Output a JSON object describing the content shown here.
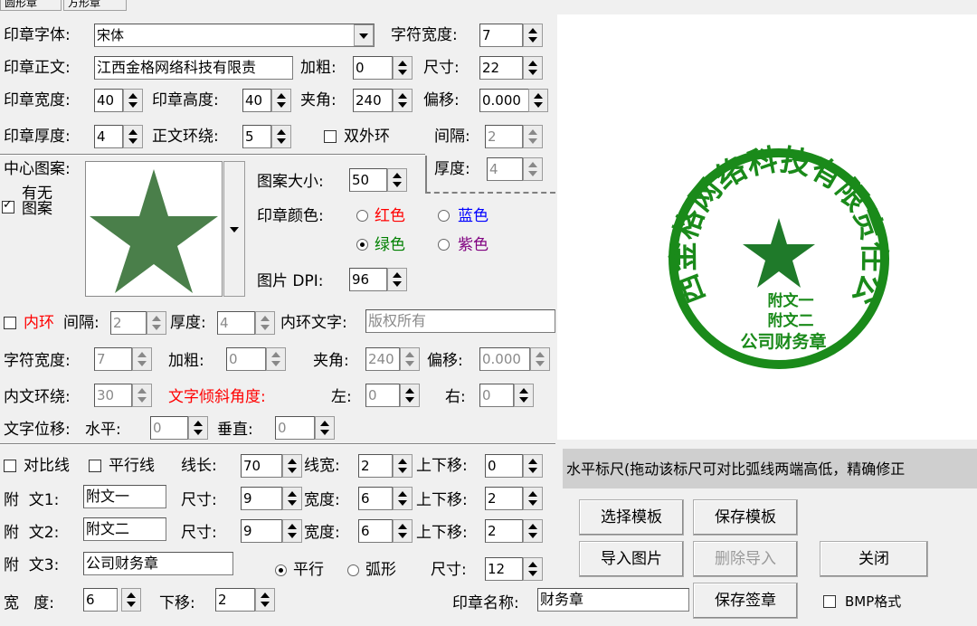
{
  "tabs": [
    "圆形章",
    "方形章"
  ],
  "font": {
    "label": "印章字体:",
    "value": "宋体"
  },
  "char_width": {
    "label": "字符宽度:",
    "value": "7"
  },
  "main_text": {
    "label": "印章正文:",
    "value": "江西金格网络科技有限责"
  },
  "bold": {
    "label": "加粗:",
    "value": "0"
  },
  "size": {
    "label": "尺寸:",
    "value": "22"
  },
  "seal_width": {
    "label": "印章宽度:",
    "value": "40"
  },
  "seal_height": {
    "label": "印章高度:",
    "value": "40"
  },
  "angle": {
    "label": "夹角:",
    "value": "240"
  },
  "offset": {
    "label": "偏移:",
    "value": "0.000"
  },
  "seal_thickness": {
    "label": "印章厚度:",
    "value": "4"
  },
  "text_wrap": {
    "label": "正文环绕:",
    "value": "5"
  },
  "double_ring": {
    "label": "双外环",
    "checked": false
  },
  "gap": {
    "label": "间隔:",
    "value": "2"
  },
  "thickness2": {
    "label": "厚度:",
    "value": "4"
  },
  "center_pattern": {
    "label": "中心图案:",
    "has_pattern": "有无图案",
    "checked": true
  },
  "pattern_size": {
    "label": "图案大小:",
    "value": "50"
  },
  "seal_color": {
    "label": "印章颜色:",
    "options": [
      {
        "label": "红色",
        "color": "#ff0000",
        "selected": false
      },
      {
        "label": "蓝色",
        "color": "#0000ff",
        "selected": false
      },
      {
        "label": "绿色",
        "color": "#008000",
        "selected": true
      },
      {
        "label": "紫色",
        "color": "#800080",
        "selected": false
      }
    ]
  },
  "dpi": {
    "label": "图片 DPI:",
    "value": "96"
  },
  "inner_ring": {
    "label": "内环",
    "checked": false,
    "gap_label": "间隔:",
    "gap": "2",
    "thickness_label": "厚度:",
    "thickness": "4",
    "text_label": "内环文字:",
    "text": "版权所有"
  },
  "inner_char_width": {
    "label": "字符宽度:",
    "value": "7"
  },
  "inner_bold": {
    "label": "加粗:",
    "value": "0"
  },
  "inner_angle": {
    "label": "夹角:",
    "value": "240"
  },
  "inner_offset": {
    "label": "偏移:",
    "value": "0.000"
  },
  "inner_wrap": {
    "label": "内文环绕:",
    "value": "30"
  },
  "tilt": {
    "label": "文字倾斜角度:",
    "left_label": "左:",
    "left": "0",
    "right_label": "右:",
    "right": "0"
  },
  "text_shift": {
    "label": "文字位移:",
    "h_label": "水平:",
    "h": "0",
    "v_label": "垂直:",
    "v": "0"
  },
  "compare_line": {
    "label": "对比线",
    "checked": false
  },
  "parallel_line": {
    "label": "平行线",
    "checked": false
  },
  "line_len": {
    "label": "线长:",
    "value": "70"
  },
  "line_width": {
    "label": "线宽:",
    "value": "2"
  },
  "line_shift": {
    "label": "上下移:",
    "value": "0"
  },
  "attach1": {
    "label": "附  文1:",
    "text": "附文一",
    "size_label": "尺寸:",
    "size": "9",
    "width_label": "宽度:",
    "width": "6",
    "shift_label": "上下移:",
    "shift": "2"
  },
  "attach2": {
    "label": "附  文2:",
    "text": "附文二",
    "size_label": "尺寸:",
    "size": "9",
    "width_label": "宽度:",
    "width": "6",
    "shift_label": "上下移:",
    "shift": "2"
  },
  "attach3": {
    "label": "附  文3:",
    "text": "公司财务章",
    "parallel": "平行",
    "arc": "弧形",
    "size_label": "尺寸:",
    "size": "12"
  },
  "bottom": {
    "width_label": "宽   度:",
    "width": "6",
    "down_label": "下移:",
    "down": "2",
    "name_label": "印章名称:",
    "name": "财务章"
  },
  "ruler_text": "水平标尺(拖动该标尺可对比弧线两端高低，精确修正",
  "buttons": {
    "select_template": "选择模板",
    "save_template": "保存模板",
    "import_image": "导入图片",
    "delete_import": "删除导入",
    "close": "关闭",
    "save_seal": "保存签章"
  },
  "bmp": {
    "label": "BMP格式",
    "checked": false
  },
  "preview": {
    "arc_text": "江西金格网络科技有限责任公司",
    "line1": "附文一",
    "line2": "附文二",
    "line3": "公司财务章",
    "color": "#1a8a1a"
  }
}
